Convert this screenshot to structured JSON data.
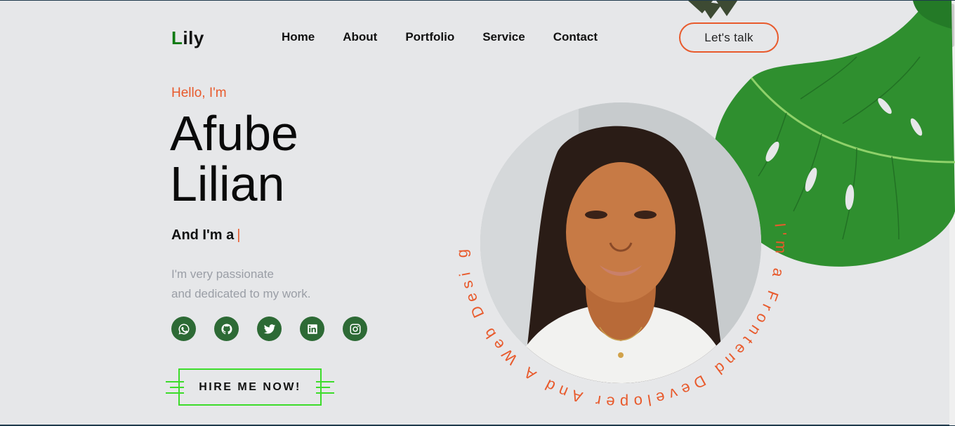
{
  "brand": {
    "logo_first": "L",
    "logo_rest": "ily"
  },
  "nav": {
    "items": [
      {
        "label": "Home"
      },
      {
        "label": "About"
      },
      {
        "label": "Portfolio"
      },
      {
        "label": "Service"
      },
      {
        "label": "Contact"
      }
    ]
  },
  "header": {
    "cta_label": "Let's talk"
  },
  "hero": {
    "greeting": "Hello, I'm",
    "name_line1": "Afube",
    "name_line2": "Lilian",
    "role_prefix": "And I'm a",
    "cursor": "|",
    "desc_line1": "I'm very passionate",
    "desc_line2": "and dedicated to my work.",
    "hire_label": "HIRE ME NOW!",
    "circle_text": "I'm a Frontend Developer And A Web Desi gner - "
  },
  "socials": [
    {
      "icon": "whatsapp-icon"
    },
    {
      "icon": "github-icon"
    },
    {
      "icon": "twitter-icon"
    },
    {
      "icon": "linkedin-icon"
    },
    {
      "icon": "instagram-icon"
    }
  ],
  "colors": {
    "accent": "#e85a2c",
    "brand_green": "#0f7a12",
    "social_bg": "#2d6a35",
    "hire_border": "#3ddc2b",
    "background": "#e6e7e9"
  }
}
